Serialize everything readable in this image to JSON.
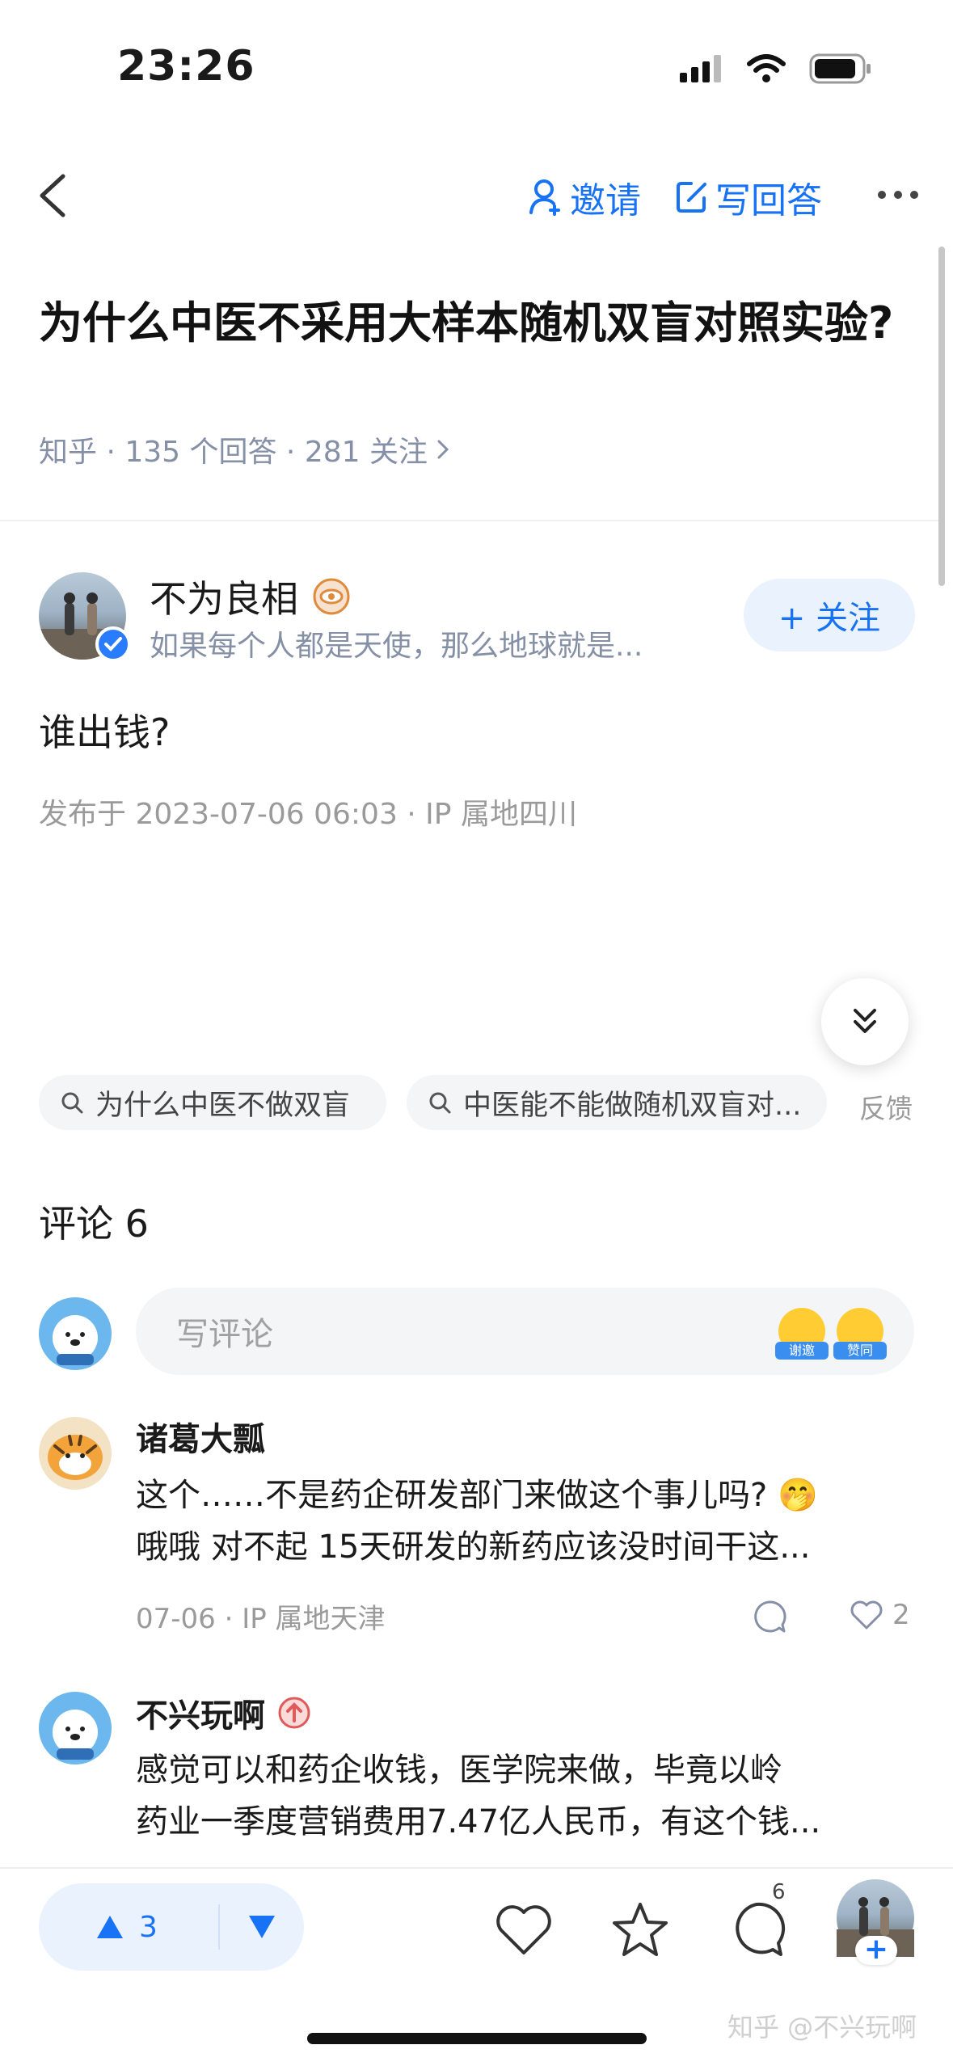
{
  "status_bar": {
    "time": "23:26"
  },
  "nav": {
    "invite_label": "邀请",
    "write_answer_label": "写回答"
  },
  "question": {
    "title": "为什么中医不采用大样本随机双盲对照实验?",
    "meta": "知乎 · 135 个回答 · 281 关注"
  },
  "answer": {
    "author_name": "不为良相",
    "author_signature": "如果每个人都是天使，那么地球就是...",
    "follow_label": "+ 关注",
    "content": "谁出钱?",
    "published": "发布于 2023-07-06 06:03 · IP 属地四川"
  },
  "related_searches": [
    "为什么中医不做双盲",
    "中医能不能做随机双盲对..."
  ],
  "feedback_label": "反馈",
  "comments": {
    "title": "评论 6",
    "input_placeholder": "写评论",
    "emoji_labels": [
      "谢邀",
      "赞同"
    ],
    "items": [
      {
        "name": "诸葛大瓢",
        "lines": [
          "这个……不是药企研发部门来做这个事儿吗? 🤭",
          "哦哦 对不起 15天研发的新药应该没时间干这..."
        ],
        "meta": "07-06 ·  IP 属地天津",
        "likes": "2"
      },
      {
        "name": "不兴玩啊",
        "lines": [
          "感觉可以和药企收钱，医学院来做，毕竟以岭",
          "药业一季度营销费用7.47亿人民币，有这个钱..."
        ]
      }
    ]
  },
  "bottom_bar": {
    "upvotes": "3",
    "comment_count": "6"
  },
  "watermark": "知乎 @不兴玩啊",
  "colors": {
    "accent": "#1772f6",
    "accent_bg": "#eaf2fd",
    "secondary_text": "#8590a6"
  }
}
